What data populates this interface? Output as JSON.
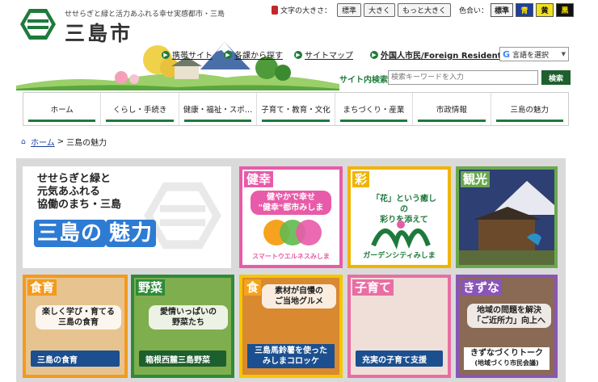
{
  "header": {
    "tagline": "せせらぎと緑と活力あふれる幸せ実感都市・三島",
    "city_name": "三島市",
    "font_size": {
      "label": "文字の大きさ：",
      "buttons": [
        "標準",
        "大きく",
        "もっと大きく"
      ]
    },
    "color": {
      "label": "色合い：",
      "buttons": [
        "標準",
        "青",
        "黄",
        "黒"
      ]
    },
    "links": [
      "携帯サイト",
      "各課から探す",
      "サイトマップ"
    ],
    "foreign": "外国人市民/Foreign Residents",
    "translate": {
      "label": "言語を選択",
      "prefix": "G"
    },
    "search": {
      "label": "サイト内検索",
      "placeholder": "検索キーワードを入力",
      "button": "検索"
    }
  },
  "gnav": [
    "ホーム",
    "くらし・手続き",
    "健康・福祉・スポ…",
    "子育て・教育・文化",
    "まちづくり・産業",
    "市政情報",
    "三島の魅力"
  ],
  "breadcrumb": {
    "home": "ホーム",
    "sep": ">",
    "current": "三島の魅力"
  },
  "hero": {
    "text": "せせらぎと緑と\n元気あふれる\n協働のまち・三島",
    "big_pre": "三島の",
    "big_em": "魅力"
  },
  "tiles": [
    {
      "tag": "健幸",
      "body": "健やかで幸せ\n\"健幸\"都市みしま",
      "footer": "スマートウエルネスみしま"
    },
    {
      "tag": "彩",
      "body": "「花」という癒しの\n彩りを添えて",
      "footer": "ガーデンシティみしま"
    },
    {
      "tag": "観光"
    },
    {
      "tag": "食育",
      "body": "楽しく学び・育てる\n三島の食育",
      "footer": "三島の食育"
    },
    {
      "tag": "野菜",
      "body": "愛情いっぱいの\n野菜たち",
      "footer": "箱根西麓三島野菜"
    },
    {
      "tag": "食",
      "body": "素材が自慢の\nご当地グルメ",
      "footer": "三島馬鈴薯を使った\nみしまコロッケ"
    },
    {
      "tag": "子育て",
      "footer": "充実の子育て支援"
    },
    {
      "tag": "きずな",
      "body": "地域の問題を解決\n「ご近所力」向上へ",
      "footer": "きずなづくりトーク",
      "sub": "(地域づくり市民会議)"
    }
  ],
  "colors": {
    "brand_green": "#1e7a3c",
    "link_blue": "#1a3f9e"
  }
}
